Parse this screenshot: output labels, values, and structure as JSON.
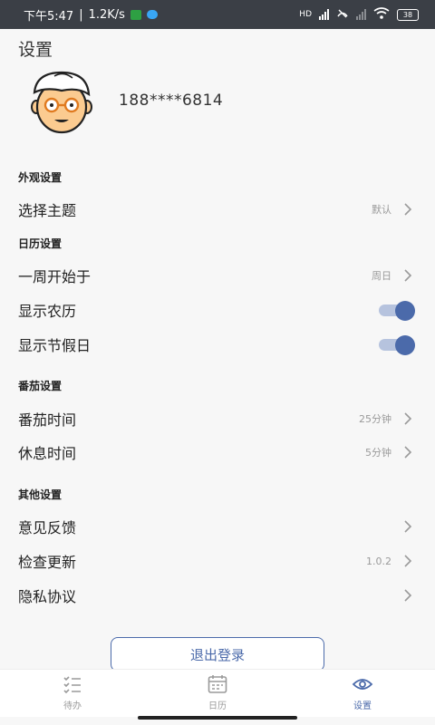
{
  "status_bar": {
    "time": "下午5:47",
    "speed": "1.2K/s",
    "network_label": "HD",
    "battery": "38"
  },
  "header": {
    "title": "设置"
  },
  "profile": {
    "phone": "188****6814"
  },
  "sections": {
    "appearance": {
      "title": "外观设置",
      "theme": {
        "label": "选择主题",
        "value": "默认"
      }
    },
    "calendar": {
      "title": "日历设置",
      "week_start": {
        "label": "一周开始于",
        "value": "周日"
      },
      "lunar": {
        "label": "显示农历",
        "on": true
      },
      "holidays": {
        "label": "显示节假日",
        "on": true
      }
    },
    "pomodoro": {
      "title": "番茄设置",
      "work": {
        "label": "番茄时间",
        "value": "25分钟"
      },
      "rest": {
        "label": "休息时间",
        "value": "5分钟"
      }
    },
    "other": {
      "title": "其他设置",
      "feedback": {
        "label": "意见反馈"
      },
      "update": {
        "label": "检查更新",
        "value": "1.0.2"
      },
      "privacy": {
        "label": "隐私协议"
      }
    }
  },
  "logout_label": "退出登录",
  "nav": {
    "todo": {
      "label": "待办",
      "icon": "checklist-icon"
    },
    "calendar": {
      "label": "日历",
      "icon": "calendar-icon"
    },
    "settings": {
      "label": "设置",
      "icon": "eye-icon",
      "active": true
    }
  },
  "colors": {
    "accent": "#4b6aaa",
    "toggle_track": "#b6c3de",
    "muted": "#9a9a9a"
  }
}
